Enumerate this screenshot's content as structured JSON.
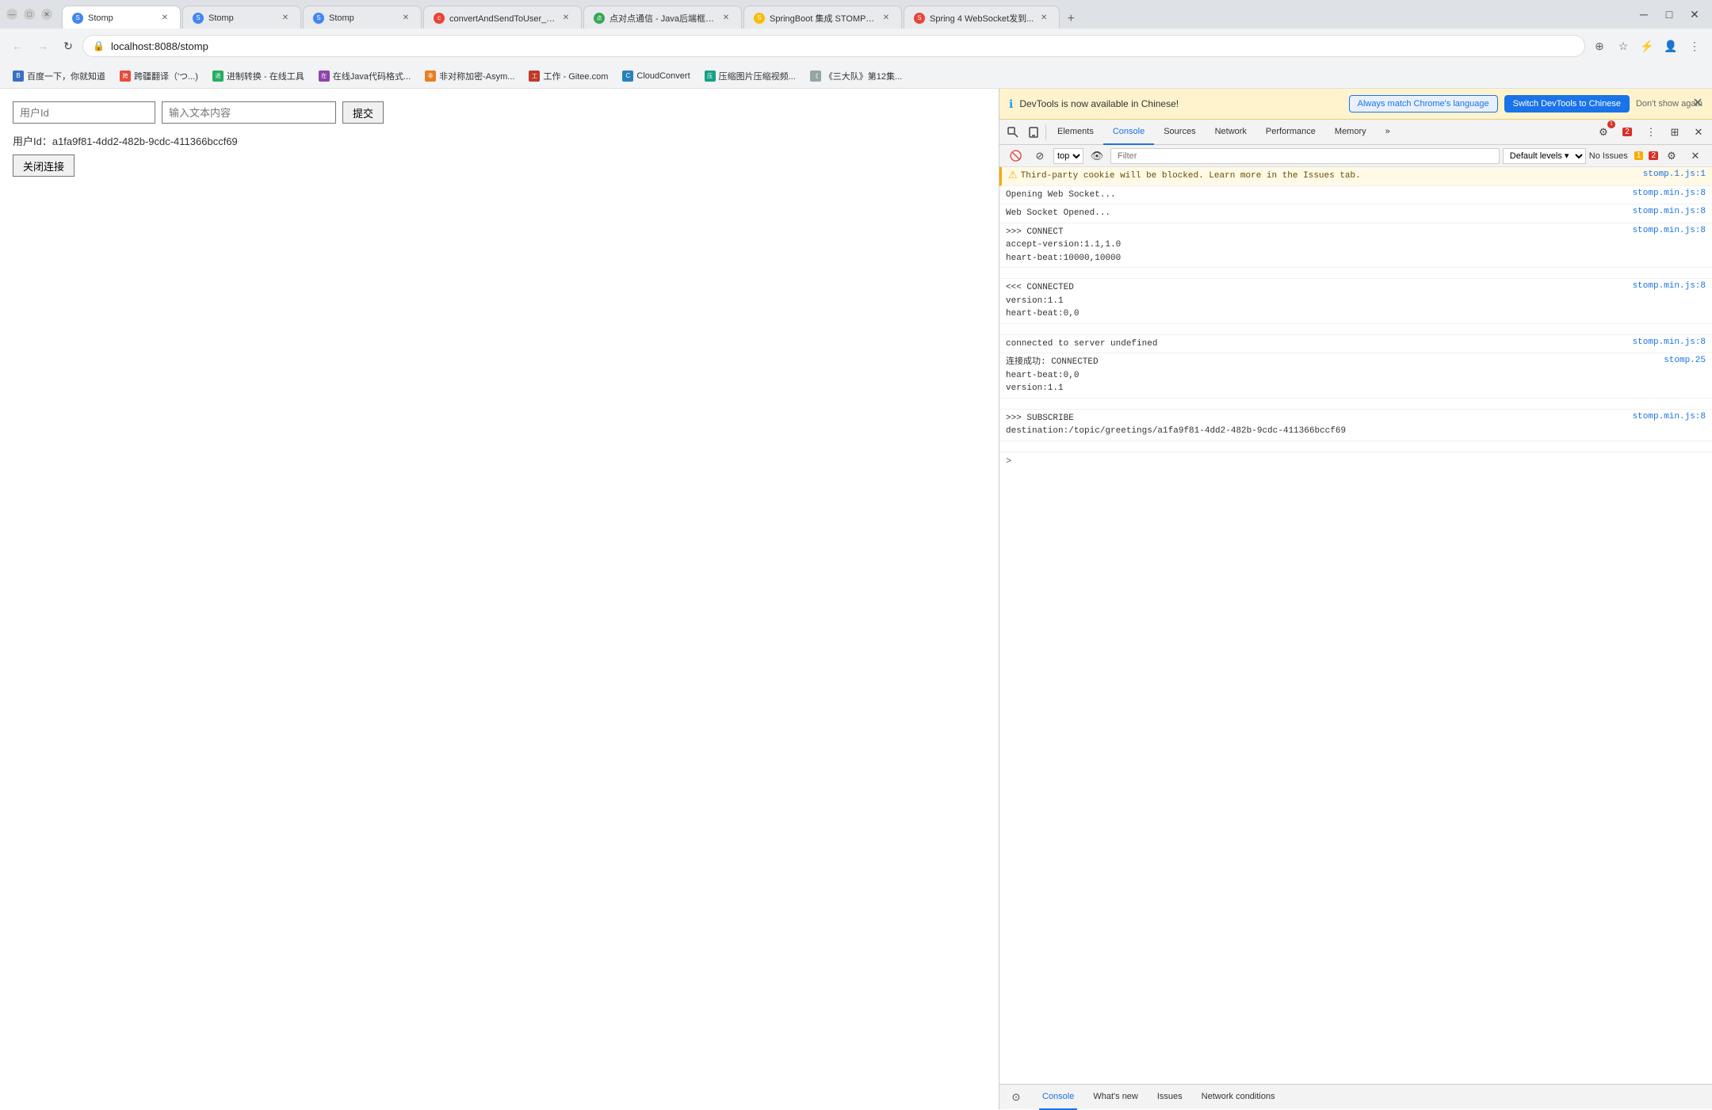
{
  "browser": {
    "tabs": [
      {
        "id": "tab1",
        "title": "Stomp",
        "url": "localhost:8088/stomp",
        "active": true,
        "favicon": "S"
      },
      {
        "id": "tab2",
        "title": "Stomp",
        "url": "localhost:8088/stomp",
        "active": false,
        "favicon": "S"
      },
      {
        "id": "tab3",
        "title": "Stomp",
        "url": "localhost:8088/stomp",
        "active": false,
        "favicon": "S"
      },
      {
        "id": "tab4",
        "title": "convertAndSendToUser_百三...",
        "url": "",
        "active": false,
        "favicon": "c"
      },
      {
        "id": "tab5",
        "title": "点对点通信 - Java后端框架库",
        "url": "",
        "active": false,
        "favicon": "点"
      },
      {
        "id": "tab6",
        "title": "SpringBoot 集成 STOMP 实三...",
        "url": "",
        "active": false,
        "favicon": "S"
      },
      {
        "id": "tab7",
        "title": "Spring 4 WebSocket发到...",
        "url": "",
        "active": false,
        "favicon": "S"
      }
    ],
    "address_bar": {
      "url": "localhost:8088/stomp",
      "lock_icon": "🔒"
    },
    "bookmarks": [
      {
        "label": "百度一下，你就知道",
        "icon": "B"
      },
      {
        "label": "跨疆翻译（'つ...)",
        "icon": "跨"
      },
      {
        "label": "进制转换 - 在线工具",
        "icon": "进"
      },
      {
        "label": "在线Java代码格式...",
        "icon": "在"
      },
      {
        "label": "非对称加密-Asym...",
        "icon": "非"
      },
      {
        "label": "工作 - Gitee.com",
        "icon": "工"
      },
      {
        "label": "CloudConvert",
        "icon": "C"
      },
      {
        "label": "压缩图片压缩视频...",
        "icon": "压"
      },
      {
        "label": "《三大队》第12集...",
        "icon": "《"
      }
    ]
  },
  "page": {
    "user_id_placeholder": "用户Id",
    "message_placeholder": "输入文本内容",
    "submit_label": "提交",
    "user_id_display": "用户Id：a1fa9f81-4dd2-482b-9cdc-411366bccf69",
    "close_conn_label": "关闭连接"
  },
  "devtools": {
    "notification": {
      "icon": "ℹ",
      "text": "DevTools is now available in Chinese!",
      "btn_match_label": "Always match Chrome's language",
      "btn_switch_label": "Switch DevTools to Chinese",
      "dont_show_label": "Don't show again"
    },
    "main_tabs": [
      {
        "label": "Elements",
        "active": false
      },
      {
        "label": "Console",
        "active": true
      },
      {
        "label": "Sources",
        "active": false
      },
      {
        "label": "Network",
        "active": false
      },
      {
        "label": "Performance",
        "active": false
      },
      {
        "label": "Memory",
        "active": false
      }
    ],
    "toolbar2": {
      "filter_placeholder": "Filter",
      "level_label": "Default levels",
      "issues_label": "No Issues",
      "issues_count": "2"
    },
    "console_lines": [
      {
        "type": "warn",
        "text": "Third-party cookie will be blocked. Learn more in the Issues tab.",
        "link": "stomp.1.js:1",
        "icon": "⚠"
      },
      {
        "type": "log",
        "text": "Opening Web Socket...",
        "link": "stomp.min.js:8",
        "icon": ""
      },
      {
        "type": "log",
        "text": "Web Socket Opened...",
        "link": "stomp.min.js:8",
        "icon": ""
      },
      {
        "type": "log",
        "text": ">>> CONNECT\naccept-version:1.1,1.0\nheart-beat:10000,10000",
        "link": "stomp.min.js:8",
        "icon": ""
      },
      {
        "type": "log",
        "text": "",
        "link": "",
        "icon": ""
      },
      {
        "type": "log",
        "text": "<<< CONNECTED\nversion:1.1\nheart-beat:0,0",
        "link": "stomp.min.js:8",
        "icon": ""
      },
      {
        "type": "log",
        "text": "",
        "link": "",
        "icon": ""
      },
      {
        "type": "log",
        "text": "connected to server undefined",
        "link": "stomp.min.js:8",
        "icon": ""
      },
      {
        "type": "log",
        "text": "连接成功: CONNECTED\nheart-beat:0,0\nversion:1.1",
        "link": "stomp.25",
        "icon": ""
      },
      {
        "type": "log",
        "text": "",
        "link": "",
        "icon": ""
      },
      {
        "type": "log",
        "text": ">>> SUBSCRIBE\ndestination:/topic/greetings/a1fa9f81-4dd2-482b-9cdc-411366bccf69",
        "link": "stomp.min.js:8",
        "icon": ""
      },
      {
        "type": "log",
        "text": "",
        "link": "",
        "icon": ""
      }
    ],
    "caret": ">",
    "bottom_tabs": [
      {
        "label": "Console",
        "active": true
      },
      {
        "label": "What's new",
        "active": false
      },
      {
        "label": "Issues",
        "active": false
      },
      {
        "label": "Network conditions",
        "active": false
      }
    ]
  }
}
